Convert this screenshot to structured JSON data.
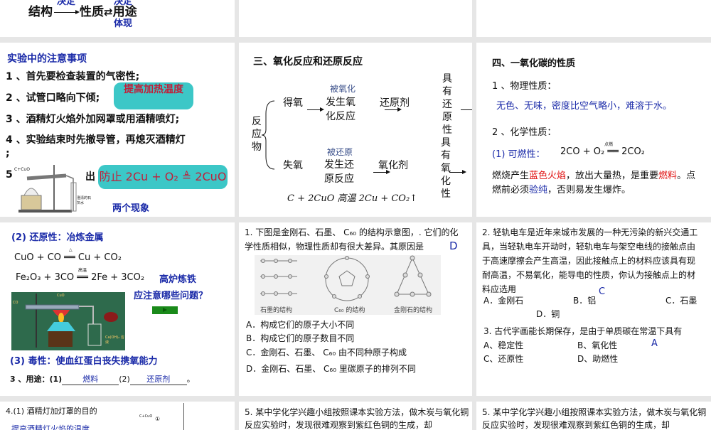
{
  "slide1": {
    "structure": "结构",
    "property": "性质",
    "use": "用途",
    "label_determine_1": "决定",
    "label_determine_2": "决定",
    "label_reflect": "体现"
  },
  "slide4": {
    "title": "实验中的注意事项",
    "items": [
      "1 、首先要检查装置的气密性;",
      "2 、试管口略向下倾;",
      "3 、酒精灯火焰外加网罩或用酒精喷灯;",
      "4 、实验结束时先撤导管，再熄灭酒精灯",
      ";",
      "5 ",
      "出"
    ],
    "bubble1": "提高加热温度",
    "bubble2": "防止 2Cu + O₂ ≜ 2CuO",
    "phenomena": "两个现象",
    "img_label_reactant": "C+CuO",
    "img_label_limewater": "澄清的石灰水"
  },
  "slide5": {
    "title": "三、氧化反应和还原反应",
    "reactant": "反应物",
    "gain": "得氧",
    "oxidized": "被氧化",
    "oxidation_rxn": "发生氧化反应",
    "reducer": "还原剂",
    "reducing_prop": "具有还原性",
    "lose": "失氧",
    "reduced": "被还原",
    "reduction_rxn": "发生还原反应",
    "oxidizer": "氧化剂",
    "oxidizing_prop": "具有氧化性",
    "equation": "C + 2CuO 高温 2Cu + CO₂↑"
  },
  "slide6": {
    "title": "四、一氧化碳的性质",
    "phys_heading": "1 、物理性质：",
    "phys_text": "无色、无味，密度比空气略小，难溶于水。",
    "chem_heading": "2 、化学性质：",
    "combust_label": "(1) 可燃性：",
    "combust_eq": "2CO + O₂ ══ 2CO₂",
    "combust_cond": "点燃",
    "desc_1": "燃烧产生",
    "desc_blue_flame": "蓝色火焰",
    "desc_2": "，放出大量热，是重要",
    "desc_fuel": "燃料",
    "desc_3": "。点燃前必须",
    "desc_purity": "验纯",
    "desc_4": "，否则易发生爆炸。"
  },
  "slide7": {
    "reduce_heading": "(2) 还原性：冶炼金属",
    "eq1": "CuO + CO ══ Cu + CO₂",
    "eq1_cond": "△",
    "eq2": "Fe₂O₃ + 3CO ══ 2Fe + 3CO₂",
    "eq2_cond": "高温",
    "blast_furnace": "高炉炼铁",
    "question": "应注意哪些问题？",
    "img_cuo": "CuO",
    "img_co": "CO",
    "img_lime": "Ca(OH)₂ 溶液",
    "toxic": "(3) 毒性：使血红蛋白丧失携氧能力",
    "use_prefix": "3 、用途：(1)",
    "use1": "燃料",
    "use_mid": "(2)",
    "use2": "还原剂",
    "use_end": "。"
  },
  "slide8": {
    "question": "1. 下图是金刚石、石墨、 C₆₀ 的结构示意图，. 它们的化学性质相似，物理性质却有很大差异。其原因是",
    "answer": "D",
    "captions": [
      "石墨的结构",
      "C₆₀ 的结构",
      "金刚石的结构"
    ],
    "options": [
      "A．构成它们的原子大小不同",
      "B．构成它们的原子数目不同",
      "C．金刚石、石墨、 C₆₀ 由不同种原子构成",
      "D．金刚石、石墨、 C₆₀ 里碳原子的排列不同"
    ]
  },
  "slide9": {
    "q2": "2. 轻轨电车是近年来城市发展的一种无污染的新兴交通工具，当轻轨电车开动时，轻轨电车与架空电线的接触点由于高速摩擦会产生高温，因此接触点上的材料应该具有现耐高温，不易氧化，能导电的性质，你认为接触点上的材料应选用",
    "q2_answer": "C",
    "q2_options": [
      "A．金刚石",
      "B．铝",
      "C．石墨",
      "D．铜"
    ],
    "q3": "3. 古代字画能长期保存，是由于单质碳在常温下具有",
    "q3_answer": "A",
    "q3_options": [
      "A、稳定性",
      "B、氧化性",
      "C、还原性",
      "D、助燃性"
    ]
  },
  "slide10": {
    "q4": "4.(1) 酒精灯加灯罩的目的",
    "a4": "提高酒精灯火焰的温度",
    "img_label": "C+CuO",
    "marker": "①"
  },
  "slide11": {
    "q5": "5. 某中学化学兴趣小组按照课本实验方法，做木炭与氧化铜反应实验时，发现很难观察到紫红色铜的生成，却"
  },
  "slide12": {
    "q5": "5. 某中学化学兴趣小组按照课本实验方法，做木炭与氧化铜反应实验时，发现很难观察到紫红色铜的生成，却"
  }
}
